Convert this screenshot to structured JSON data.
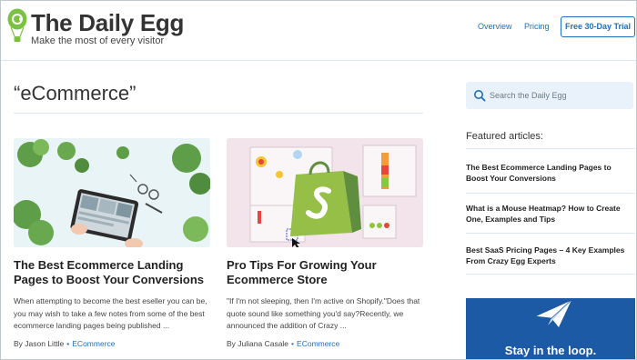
{
  "header": {
    "brand_title": "The Daily Egg",
    "brand_tagline": "Make the most of every visitor",
    "nav": {
      "overview": "Overview",
      "pricing": "Pricing"
    },
    "trial_button": "Free 30-Day Trial"
  },
  "main": {
    "page_title": "“eCommerce”",
    "articles": [
      {
        "title": "The Best Ecommerce Landing Pages to Boost Your Conversions",
        "excerpt": "When attempting to become the best eseller you can be, you may wish to take a few notes from some of the best ecommerce landing pages being published ...",
        "author": "By Jason Little",
        "category": "ECommerce",
        "image_icon": "tablet-desk-photo"
      },
      {
        "title": "Pro Tips For Growing Your Ecommerce Store",
        "excerpt": "\"If I'm not sleeping, then I'm active on Shopify.\"Does that quote sound like something you'd say?Recently, we announced the addition of Crazy ...",
        "author": "By Juliana Casale",
        "category": "ECommerce",
        "image_icon": "shopify-bag-heatmap"
      }
    ]
  },
  "sidebar": {
    "search_placeholder": "Search the Daily Egg",
    "featured_heading": "Featured articles:",
    "featured": [
      "The Best Ecommerce Landing Pages to Boost Your Conversions",
      "What is a Mouse Heatmap? How to Create One, Examples and Tips",
      "Best SaaS Pricing Pages – 4 Key Examples From Crazy Egg Experts"
    ],
    "newsletter_text": "Stay in the loop."
  },
  "colors": {
    "accent": "#1e6fbf",
    "brand_green": "#7cc242",
    "newsletter_bg": "#1d5aa6"
  }
}
